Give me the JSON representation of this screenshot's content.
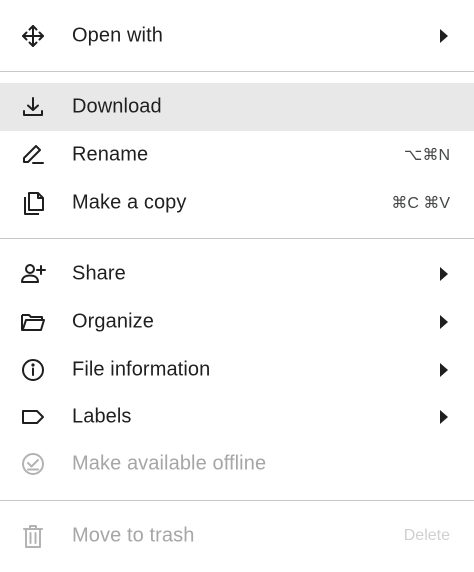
{
  "menu": {
    "open_with": {
      "label": "Open with",
      "icon": "move-arrows-icon",
      "has_submenu": true
    },
    "download": {
      "label": "Download",
      "icon": "download-icon",
      "highlighted": true
    },
    "rename": {
      "label": "Rename",
      "icon": "pen-icon",
      "shortcut": "⌥⌘N"
    },
    "make_copy": {
      "label": "Make a copy",
      "icon": "copy-icon",
      "shortcut": "⌘C ⌘V"
    },
    "share": {
      "label": "Share",
      "icon": "add-person-icon",
      "has_submenu": true
    },
    "organize": {
      "label": "Organize",
      "icon": "folder-open-icon",
      "has_submenu": true
    },
    "file_information": {
      "label": "File information",
      "icon": "info-icon",
      "has_submenu": true
    },
    "labels": {
      "label": "Labels",
      "icon": "label-tag-icon",
      "has_submenu": true
    },
    "offline": {
      "label": "Make available offline",
      "icon": "offline-check-icon",
      "disabled": true
    },
    "trash": {
      "label": "Move to trash",
      "icon": "trash-icon",
      "shortcut": "Delete",
      "disabled": true
    }
  },
  "colors": {
    "text": "#1f1f1f",
    "disabled_text": "#a6a6a6",
    "highlight": "#e8e8e8",
    "divider": "#c7c7c7"
  }
}
